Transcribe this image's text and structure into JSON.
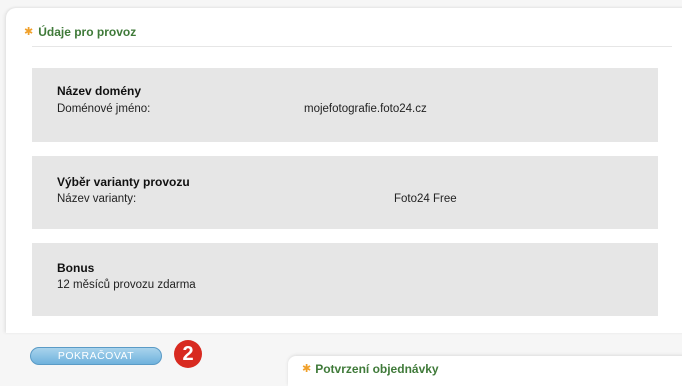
{
  "panel": {
    "title": "Údaje pro provoz",
    "icon": "star-icon"
  },
  "sections": {
    "domain": {
      "title": "Název domény",
      "label": "Doménové jméno:",
      "value": "mojefotografie.foto24.cz"
    },
    "variant": {
      "title": "Výběr varianty provozu",
      "label": "Název varianty:",
      "value": "Foto24 Free"
    },
    "bonus": {
      "title": "Bonus",
      "text": "12 měsíců provozu zdarma"
    }
  },
  "actions": {
    "continue_label": "POKRAČOVAT",
    "step_number": "2"
  },
  "next_panel": {
    "title": "Potvrzení objednávky"
  },
  "colors": {
    "header_text": "#3f7a39",
    "star": "#f0a02a",
    "section_bg": "#e6e6e6",
    "button": "#6fb2dd",
    "badge": "#d82a20"
  }
}
